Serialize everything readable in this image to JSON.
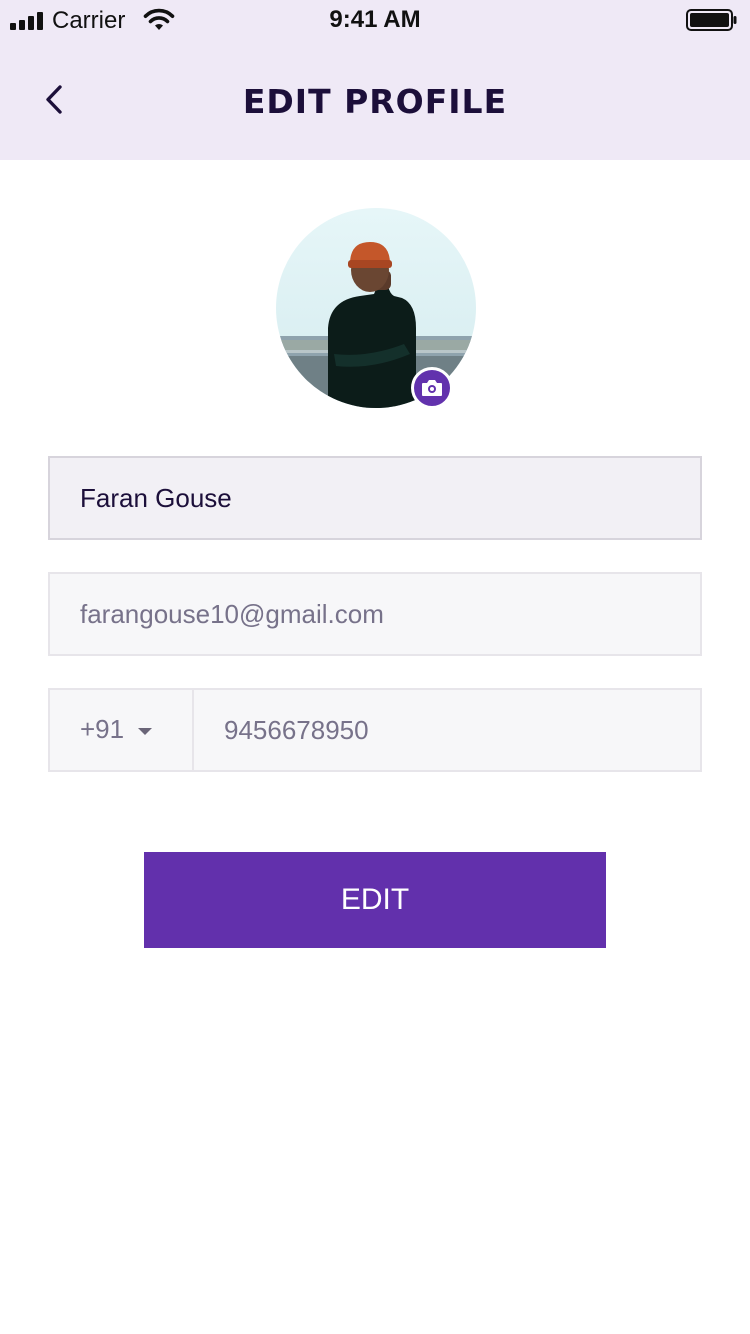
{
  "status_bar": {
    "carrier": "Carrier",
    "time": "9:41 AM",
    "icons": [
      "signal-bars-icon",
      "wifi-icon",
      "battery-icon"
    ]
  },
  "header": {
    "title": "EDIT PROFILE",
    "back_icon": "chevron-left-icon",
    "background_color": "#efe9f6"
  },
  "profile": {
    "avatar_icon": "profile-photo",
    "camera_icon": "camera-icon",
    "accent_color": "#6232ad"
  },
  "form": {
    "name_value": "Faran Gouse",
    "email_value": "farangouse10@gmail.com",
    "country_code": "+91",
    "country_code_icon": "caret-down-icon",
    "phone_value": "9456678950"
  },
  "actions": {
    "edit_label": "EDIT",
    "button_color": "#6230ac"
  }
}
